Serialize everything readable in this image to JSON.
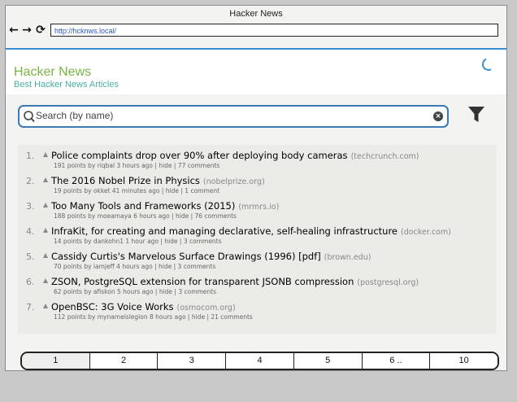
{
  "browser": {
    "window_title": "Hacker News",
    "back_icon": "←",
    "forward_icon": "→",
    "reload_icon": "⟳",
    "url": "http://hcknws.local/"
  },
  "header": {
    "title": "Hacker News",
    "subtitle": "Best Hacker News Articles",
    "title_color": "#7ab443",
    "subtitle_color": "#48b0a4",
    "accent": "#3d8dd1"
  },
  "search": {
    "placeholder": "Search (by name)"
  },
  "items": [
    {
      "rank": "1.",
      "title": "Police complaints drop over 90% after deploying body cameras",
      "domain": "(techcrunch.com)",
      "meta": "191 points by riqbal 3 hours ago | hide | 77 comments"
    },
    {
      "rank": "2.",
      "title": "The 2016 Nobel Prize in Physics",
      "domain": "(nobelprize.org)",
      "meta": "19 points by okket 41 minutes ago | hide | 1 comment"
    },
    {
      "rank": "3.",
      "title": "Too Many Tools and Frameworks (2015)",
      "domain": "(mrmrs.io)",
      "meta": "188 points by moeamaya 6 hours ago | hide | 76 comments"
    },
    {
      "rank": "4.",
      "title": "InfraKit, for creating and managing declarative, self-healing infrastructure",
      "domain": "(docker.com)",
      "meta": "14 points by dankohn1 1 hour ago | hide | 3 comments"
    },
    {
      "rank": "5.",
      "title": "Cassidy Curtis's Marvelous Surface Drawings (1996) [pdf]",
      "domain": "(brown.edu)",
      "meta": "70 points by iamjeff 4 hours ago | hide | 3 comments"
    },
    {
      "rank": "6.",
      "title": "ZSON, PostgreSQL extension for transparent JSONB compression",
      "domain": "(postgresql.org)",
      "meta": "62 points by afiskon 5 hours ago | hide | 3 comments"
    },
    {
      "rank": "7.",
      "title": "OpenBSC: 3G Voice Works",
      "domain": "(osmocom.org)",
      "meta": "112 points by mynameislegion 8 hours ago | hide | 21 comments"
    }
  ],
  "pagination": {
    "pages": [
      "1",
      "2",
      "3",
      "4",
      "5",
      "6 ..",
      "10"
    ],
    "active": "1"
  }
}
